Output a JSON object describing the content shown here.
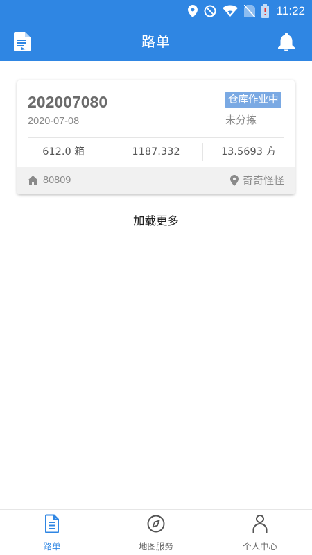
{
  "colors": {
    "primary": "#2f86e3",
    "badge": "#7aa9e3",
    "muted_text": "#8a8a8a"
  },
  "status_bar": {
    "time": "11:22"
  },
  "app_bar": {
    "title": "路单",
    "left_icon": "document-icon",
    "right_icon": "bell-icon"
  },
  "order_card": {
    "order_no": "202007080",
    "date": "2020-07-08",
    "badge": "仓库作业中",
    "sort_status": "未分拣",
    "stats": [
      "612.0 箱",
      "1187.332",
      "13.5693 方"
    ],
    "warehouse_code": "80809",
    "place": "奇奇怪怪"
  },
  "load_more": "加载更多",
  "bottom_nav": {
    "items": [
      {
        "label": "路单",
        "icon": "waybill-icon",
        "active": true
      },
      {
        "label": "地图服务",
        "icon": "compass-icon",
        "active": false
      },
      {
        "label": "个人中心",
        "icon": "person-icon",
        "active": false
      }
    ]
  }
}
